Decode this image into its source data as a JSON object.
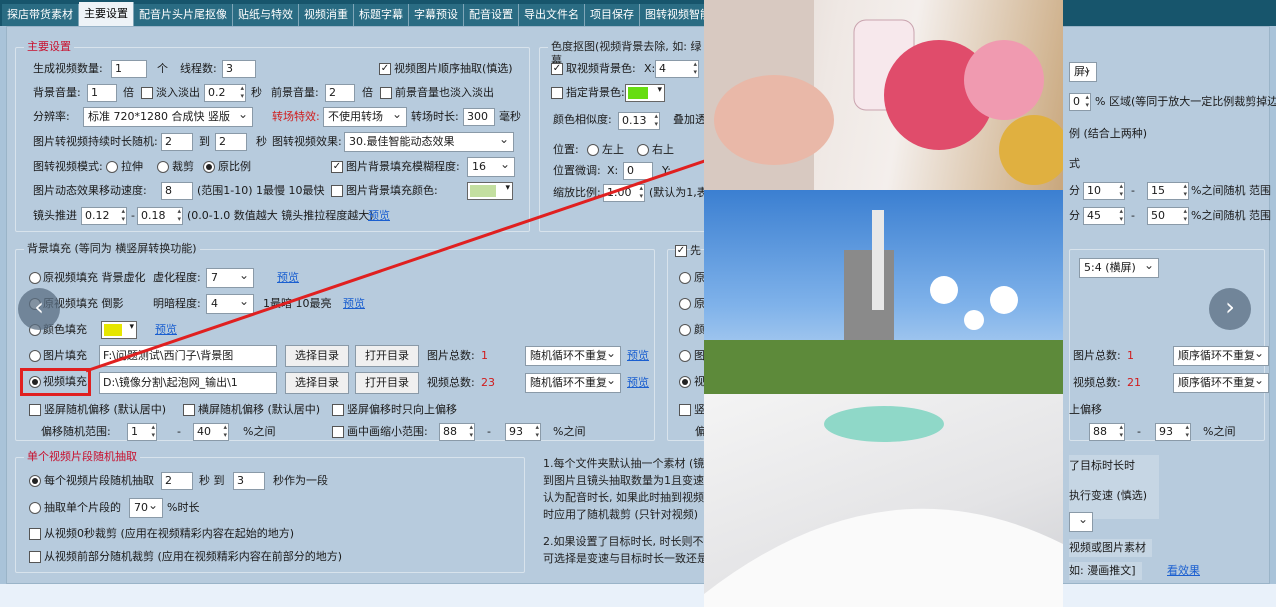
{
  "tabs": [
    "探店带货素材",
    "主要设置",
    "配音片头片尾抠像",
    "贴纸与特效",
    "视频消重",
    "标题字幕",
    "字幕预设",
    "配音设置",
    "导出文件名",
    "项目保存",
    "图转视频智能动态"
  ],
  "main": {
    "title": "主要设置",
    "gen_count_label": "生成视频数量:",
    "gen_count": "1",
    "gen_unit": "个",
    "threads_label": "线程数:",
    "threads": "3",
    "seq_extract": "视频图片顺序抽取(慎选)",
    "bg_vol_label": "背景音量:",
    "bg_vol": "1",
    "bg_vol_unit": "倍",
    "fade_label": "淡入淡出",
    "fade_val": "0.2",
    "fade_unit": "秒",
    "front_vol_label": "前景音量:",
    "front_vol": "2",
    "front_vol_unit": "倍",
    "front_fade": "前景音量也淡入淡出",
    "res_label": "分辨率:",
    "res_val": "标准 720*1280 合成快 竖版",
    "transition_label": "转场特效:",
    "transition_val": "不使用转场",
    "transition_time_label": "转场时长:",
    "transition_time": "300",
    "transition_unit": "毫秒",
    "img_dur_label": "图片转视频持续时长随机:",
    "img_dur_a": "2",
    "img_dur_to": "到",
    "img_dur_b": "2",
    "img_dur_unit": "秒",
    "img_effect_label": "图转视频效果:",
    "img_effect_val": "30.最佳智能动态效果",
    "img_mode_label": "图转视频模式:",
    "mode_stretch": "拉伸",
    "mode_crop": "裁剪",
    "mode_ratio": "原比例",
    "blur_fill_label": "图片背景填充模糊程度:",
    "blur_fill_val": "16",
    "speed_label": "图片动态效果移动速度:",
    "speed_val": "8",
    "speed_hint": "(范围1-10) 1最慢 10最快",
    "color_fill_label": "图片背景填充颜色:",
    "color_fill_hex": "#c3dfa0",
    "zoom_label": "镜头推进",
    "zoom_a": "0.12",
    "zoom_dash": "-",
    "zoom_b": "0.18",
    "zoom_hint": "(0.0-1.0 数值越大 镜头推拉程度越大)",
    "preview": "预览"
  },
  "chroma": {
    "title": "色度抠图(视频背景去除, 如: 绿幕",
    "take_color": "取视频背景色:",
    "x_label": "X:",
    "x_val": "4",
    "spec_color": "指定背景色:",
    "spec_hex": "#66dd11",
    "similarity_label": "颜色相似度:",
    "similarity_val": "0.13",
    "overlay_label": "叠加透",
    "pos_label": "位置:",
    "pos_tl": "左上",
    "pos_tr": "右上",
    "fine_label": "位置微调:",
    "fx": "X:",
    "fx_val": "0",
    "fy": "Y:",
    "scale_label": "缩放比例:",
    "scale_val": "1.00",
    "scale_hint": "(默认为1,表"
  },
  "right": {
    "sel_val": "屏)",
    "pct_val": "0",
    "pct_hint": "% 区域(等同于放大一定比例裁剪掉边",
    "ratio_hint": "例 (结合上两种)",
    "t1": "式",
    "r1_a": "10",
    "r1_b": "15",
    "r1_hint": "%之间随机 范围",
    "r1_pre": "分",
    "r2_a": "45",
    "r2_b": "50",
    "r2_hint": "%之间随机 范围",
    "r2_pre": "分",
    "aspect": "5:4 (横屏)",
    "img_total": "图片总数:",
    "img_total_val": "1",
    "img_loop": "顺序循环不重复",
    "vid_total": "视频总数:",
    "vid_total_val": "21",
    "vid_loop": "顺序循环不重复",
    "up_offset": "上偏移",
    "r3_a": "88",
    "r3_b": "93",
    "r3_hint": "%之间",
    "target": "了目标时长时",
    "speed_exec": "执行变速 (慎选)",
    "material": "视频或图片素材",
    "cartoon": "如: 漫画推文]",
    "see_effect": "看效果"
  },
  "bgfill": {
    "title": "背景填充 (等同为 横竖屏转换功能)",
    "orig_fill": "原视频填充 背景虚化",
    "blur_label": "虚化程度:",
    "blur_val": "7",
    "preview": "预览",
    "orig_shadow": "原视频填充 倒影",
    "bright_label": "明暗程度:",
    "bright_val": "4",
    "bright_hint": "1最暗 10最亮",
    "color_fill": "颜色填充",
    "color_hex": "#e6e600",
    "img_fill": "图片填充",
    "img_path": "F:\\问题测试\\西门子\\背景图",
    "choose_dir": "选择目录",
    "open_dir": "打开目录",
    "img_total": "图片总数:",
    "img_total_val": "1",
    "img_loop": "随机循环不重复",
    "vid_fill": "视频填充",
    "vid_path": "D:\\镜像分割\\起泡网_输出\\1",
    "vid_total": "视频总数:",
    "vid_total_val": "23",
    "vid_loop": "随机循环不重复",
    "v_offset": "竖屏随机偏移 (默认居中)",
    "h_offset": "横屏随机偏移 (默认居中)",
    "v_up": "竖屏偏移时只向上偏移",
    "offset_range": "偏移随机范围:",
    "off_a": "1",
    "off_b": "40",
    "off_unit": "%之间",
    "pip_label": "画中画缩小范围:",
    "pip_a": "88",
    "pip_b": "93",
    "pip_unit": "%之间"
  },
  "segment": {
    "title": "单个视频片段随机抽取",
    "each_label": "每个视频片段随机抽取",
    "each_a": "2",
    "each_to": "秒 到",
    "each_b": "3",
    "each_unit": "秒作为一段",
    "single_label": "抽取单个片段的",
    "single_val": "70",
    "single_unit": "%时长",
    "from_zero": "从视频0秒裁剪 (应用在视频精彩内容在起始的地方)",
    "from_front": "从视频前部分随机裁剪 (应用在视频精彩内容在前部分的地方)"
  },
  "notes": {
    "n1": "1.每个文件夹默认抽一个素材 (镜头",
    "n2": "到图片且镜头抽取数量为1且变速",
    "n3": "认为配音时长, 如果此时抽到视频",
    "n4": "时应用了随机裁剪 (只针对视频)",
    "n5": "2.如果设置了目标时长, 时长则不随",
    "n6": "可选择是变速与目标时长一致还是"
  },
  "partial": {
    "p1": "先",
    "p2": "原",
    "p3": "原",
    "p4": "颜",
    "p5": "图",
    "p6": "视",
    "p7": "竖",
    "p8": "偏"
  }
}
